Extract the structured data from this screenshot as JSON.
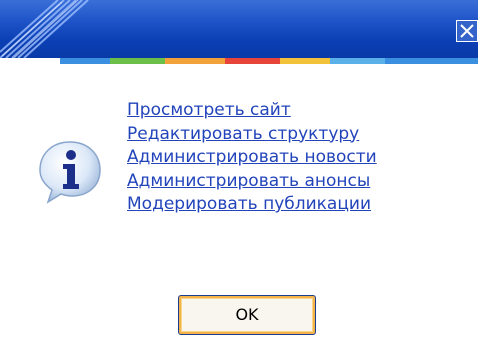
{
  "dialog": {
    "close_icon": "close-x-icon",
    "info_icon": "information-icon",
    "links": [
      "Просмотреть сайт",
      "Редактировать структуру",
      "Администрировать новости",
      "Администрировать анонсы",
      "Модерировать публикации"
    ],
    "ok_label": "OK"
  },
  "colors": {
    "titlebar": "#0a3aa8",
    "link": "#2244bb",
    "stripe": [
      "#f2a23a",
      "#6cc04a",
      "#3b8fe0",
      "#e7443a",
      "#f2c23a",
      "#5ab0e8"
    ]
  }
}
